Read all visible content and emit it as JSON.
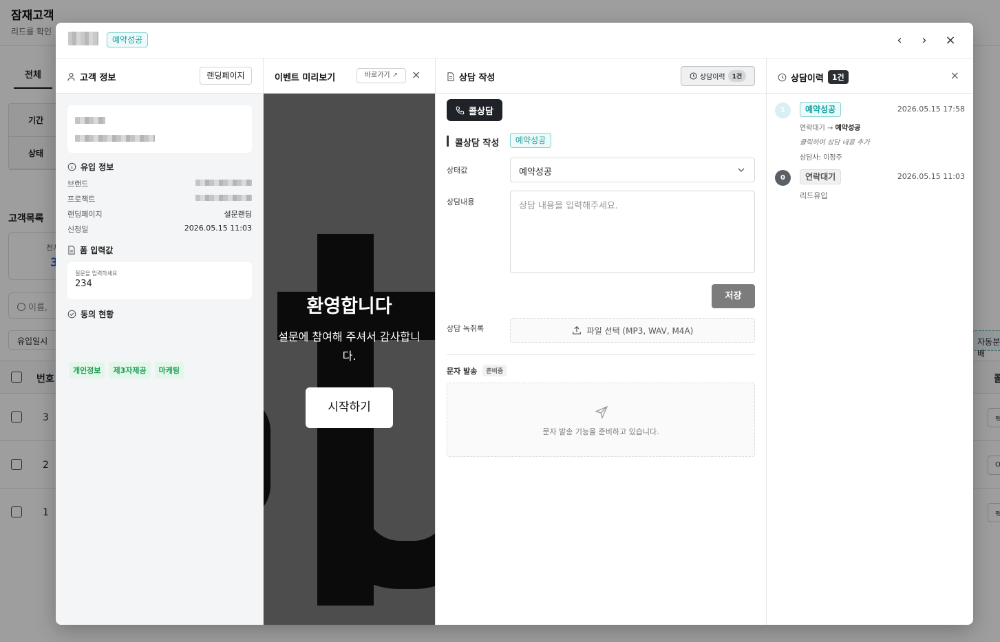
{
  "background": {
    "title": "잠재고객",
    "subtitle": "리드를 확인",
    "tab_all": "전체",
    "filter_period": "기간",
    "filter_status": "상태",
    "list_title": "고객목록",
    "card_label": "전처",
    "card_value": "3",
    "search_placeholder": "이름,",
    "chip_inflow": "유입일시",
    "th_number": "번호",
    "th_right": "콜",
    "auto_assign": "자동분배",
    "rows": [
      "3",
      "2",
      "1"
    ],
    "row_right": [
      "맥",
      "O",
      "맥"
    ]
  },
  "modal": {
    "status_badge": "예약성공",
    "prev_label": "‹",
    "next_label": "›",
    "close_label": "×"
  },
  "customer": {
    "title": "고객 정보",
    "landing_button": "랜딩페이지",
    "inflow_title": "유입 정보",
    "fields": [
      {
        "label": "브랜드",
        "value": ""
      },
      {
        "label": "프로젝트",
        "value": ""
      },
      {
        "label": "랜딩페이지",
        "value": "설문랜딩"
      },
      {
        "label": "신청일",
        "value": "2026.05.15 11:03"
      }
    ],
    "form_title": "폼 입력값",
    "form_question": "질문을 입력하세요",
    "form_answer": "234",
    "consent_title": "동의 현황",
    "consents": [
      "개인정보",
      "제3자제공",
      "마케팅"
    ]
  },
  "preview": {
    "title": "이벤트 미리보기",
    "go_button": "바로가기",
    "welcome": "환영합니다",
    "desc": "설문에 참여해 주셔서 감사합니다.",
    "start_button": "시작하기"
  },
  "consult": {
    "title": "상담 작성",
    "history_button": "상담이력",
    "history_count": "1건",
    "call_button": "콜상담",
    "section_title": "콜상담 작성",
    "section_badge": "예약성공",
    "status_label": "상태값",
    "status_value": "예약성공",
    "content_label": "상담내용",
    "content_placeholder": "상담 내용을 입력해주세요.",
    "save_button": "저장",
    "record_label": "상담 녹취록",
    "file_select": "파일 선택 (MP3, WAV, M4A)",
    "sms_label": "문자 발송",
    "sms_tag": "준비중",
    "sms_placeholder": "문자 발송 기능을 준비하고 있습니다."
  },
  "history": {
    "title": "상담이력",
    "count": "1건",
    "items": [
      {
        "dot": "1",
        "badge": "예약성공",
        "time": "2026.05.15 17:58",
        "from": "연락대기",
        "arrow": "→",
        "to": "예약성공",
        "note": "클릭하여 상담 내용 추가",
        "agent": "상담사: 이정주"
      },
      {
        "dot": "0",
        "badge": "연락대기",
        "time": "2026.05.15 11:03",
        "desc": "리드유입"
      }
    ]
  },
  "colors": {
    "accent_teal": "#19a2a2",
    "dark": "#1f2328",
    "green_tag": "#1f9d55",
    "dot_light": "#d7eff5",
    "dot_dark": "#5b5f66"
  }
}
